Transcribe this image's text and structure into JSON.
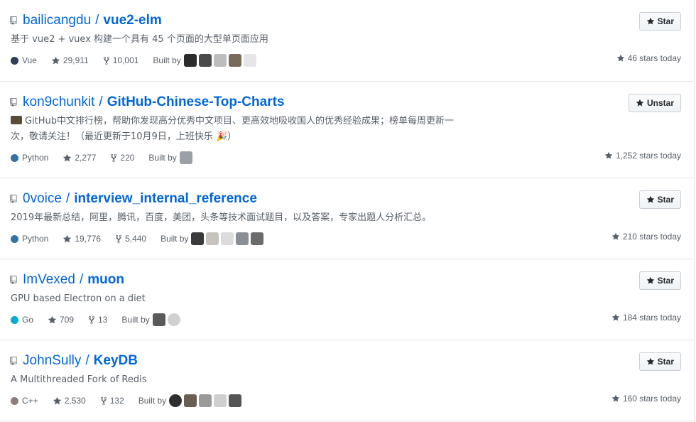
{
  "repos": [
    {
      "owner": "bailicangdu",
      "name": "vue2-elm",
      "description": "基于 vue2 + vuex 构建一个具有 45 个页面的大型单页面应用",
      "description_line2": "",
      "language": "Vue",
      "language_color": "#2c3e50",
      "stars": "29,911",
      "forks": "10,001",
      "built_by_label": "Built by",
      "button_label": "Star",
      "stars_today": "46 stars today"
    },
    {
      "owner": "kon9chunkit",
      "name": "GitHub-Chinese-Top-Charts",
      "description": "GitHub中文排行榜，帮助你发现高分优秀中文项目、更高效地吸收国人的优秀经验成果；榜单每周更新一",
      "description_line2": "次，敬请关注！（最近更新于10月9日，上班快乐 🎉）",
      "language": "Python",
      "language_color": "#3572A5",
      "stars": "2,277",
      "forks": "220",
      "built_by_label": "Built by",
      "button_label": "Unstar",
      "stars_today": "1,252 stars today"
    },
    {
      "owner": "0voice",
      "name": "interview_internal_reference",
      "description": "2019年最新总结，阿里，腾讯，百度，美团，头条等技术面试题目，以及答案，专家出题人分析汇总。",
      "description_line2": "",
      "language": "Python",
      "language_color": "#3572A5",
      "stars": "19,776",
      "forks": "5,440",
      "built_by_label": "Built by",
      "button_label": "Star",
      "stars_today": "210 stars today"
    },
    {
      "owner": "ImVexed",
      "name": "muon",
      "description": "GPU based Electron on a diet",
      "description_line2": "",
      "language": "Go",
      "language_color": "#00ADD8",
      "stars": "709",
      "forks": "13",
      "built_by_label": "Built by",
      "button_label": "Star",
      "stars_today": "184 stars today"
    },
    {
      "owner": "JohnSully",
      "name": "KeyDB",
      "description": "A Multithreaded Fork of Redis",
      "description_line2": "",
      "language": "C++",
      "language_color": "#f34b7d",
      "stars": "2,530",
      "forks": "132",
      "built_by_label": "Built by",
      "button_label": "Star",
      "stars_today": "160 stars today"
    }
  ],
  "title_separator": "/",
  "icons": {
    "repo": "repo-icon",
    "star": "star-icon",
    "fork": "fork-icon"
  }
}
